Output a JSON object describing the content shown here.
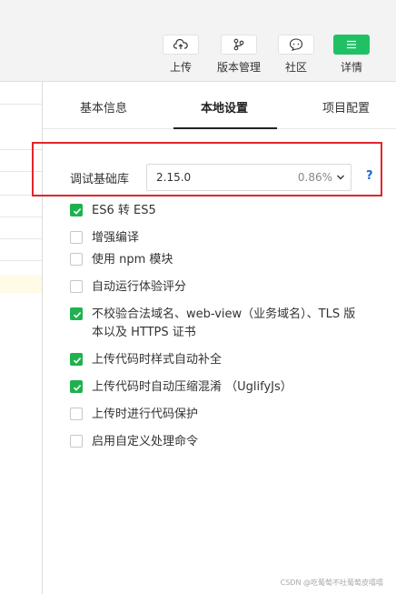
{
  "toolbar": {
    "buttons": [
      {
        "label": "上传",
        "icon": "cloud-upload-icon"
      },
      {
        "label": "版本管理",
        "icon": "branch-icon"
      },
      {
        "label": "社区",
        "icon": "chat-bubble-icon"
      },
      {
        "label": "详情",
        "icon": "menu-icon"
      }
    ]
  },
  "tabs": [
    "基本信息",
    "本地设置",
    "项目配置"
  ],
  "active_tab": "本地设置",
  "debug_lib": {
    "label": "调试基础库",
    "version": "2.15.0",
    "percent": "0.86%",
    "help": "?"
  },
  "options": [
    {
      "label": "ES6 转 ES5",
      "checked": true
    },
    {
      "label": "增强编译",
      "checked": false
    },
    {
      "label": "使用 npm 模块",
      "checked": false
    },
    {
      "label": "自动运行体验评分",
      "checked": false
    },
    {
      "label": "不校验合法域名、web-view（业务域名）、TLS 版本以及 HTTPS 证书",
      "checked": true
    },
    {
      "label": "上传代码时样式自动补全",
      "checked": true
    },
    {
      "label": "上传代码时自动压缩混淆 （UglifyJs）",
      "checked": true
    },
    {
      "label": "上传时进行代码保护",
      "checked": false
    },
    {
      "label": "启用自定义处理命令",
      "checked": false
    }
  ],
  "watermark": "CSDN @吃葡萄不吐葡萄皮嘻嘻",
  "colors": {
    "accent_green": "#20c165",
    "checkbox_green": "#20b14f",
    "highlight_red": "#e0262b",
    "help_blue": "#1f62d6"
  }
}
